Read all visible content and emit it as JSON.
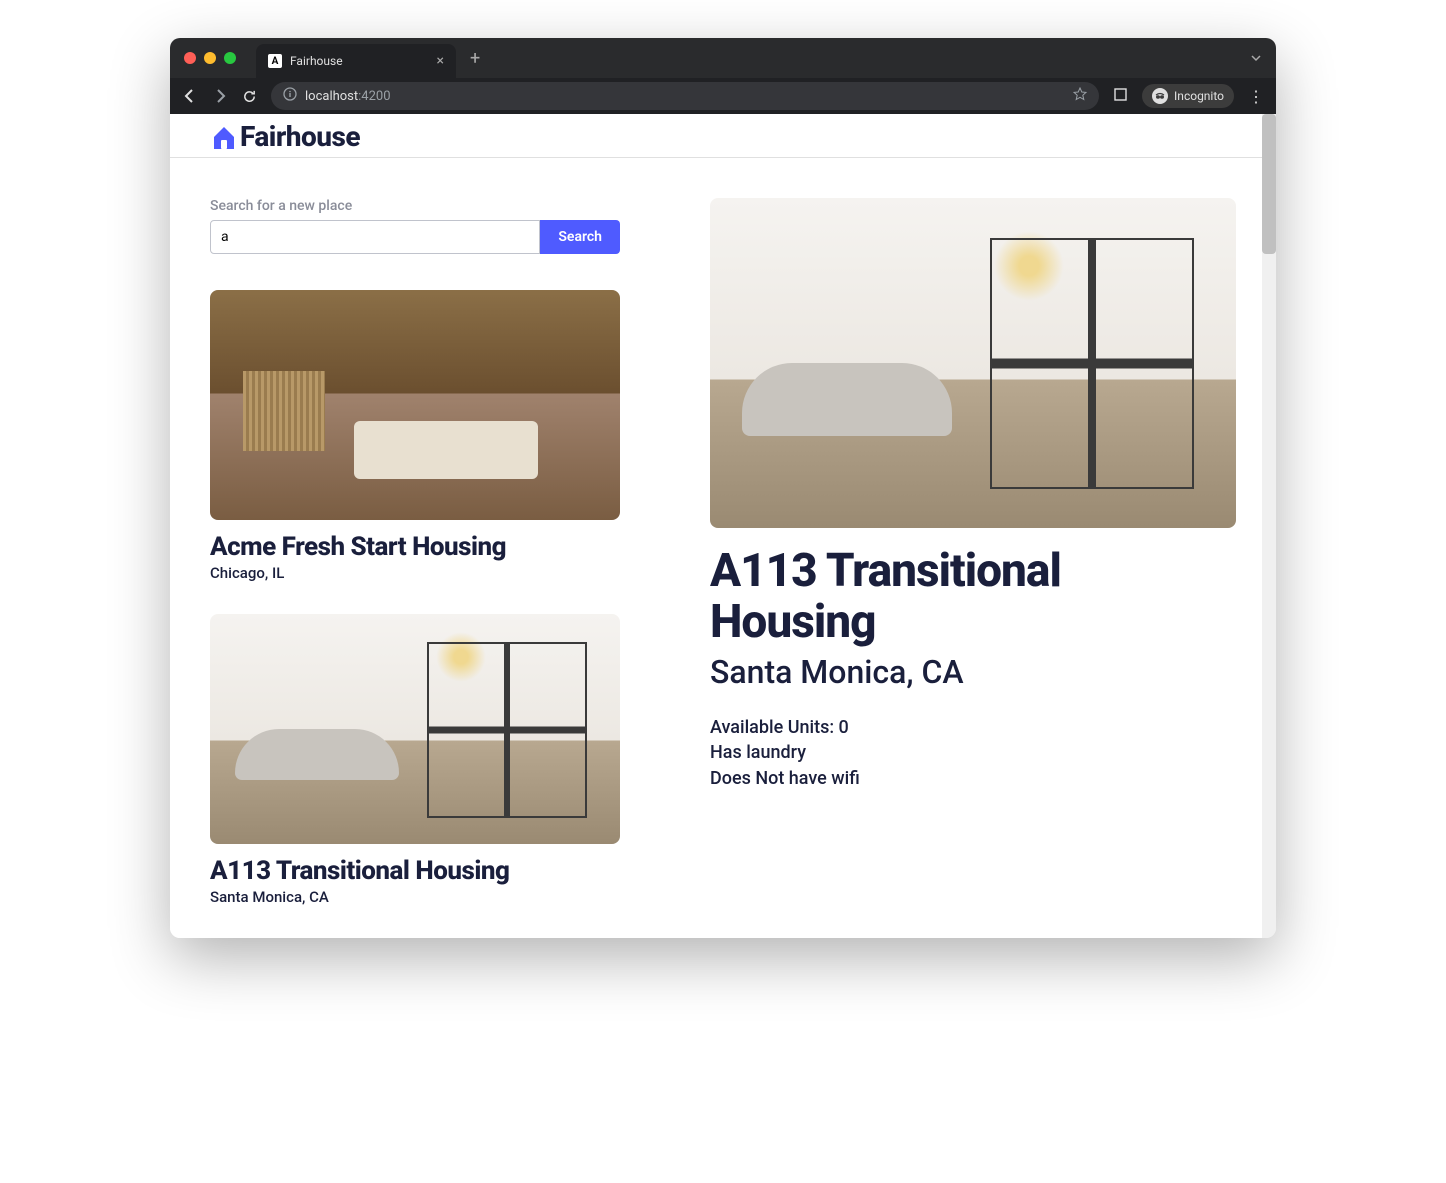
{
  "browser": {
    "tab_title": "Fairhouse",
    "tab_favicon_letter": "A",
    "address_host": "localhost",
    "address_port": ":4200",
    "incognito_label": "Incognito"
  },
  "brand": {
    "name": "Fairhouse",
    "accent_color": "#4f5bff",
    "text_color": "#1a1f3c"
  },
  "search": {
    "label": "Search for a new place",
    "value": "a",
    "button_label": "Search"
  },
  "listings": [
    {
      "title": "Acme Fresh Start Housing",
      "location": "Chicago, IL",
      "img_style": "room-warm"
    },
    {
      "title": "A113 Transitional Housing",
      "location": "Santa Monica, CA",
      "img_style": "room-light"
    }
  ],
  "detail": {
    "title": "A113 Transitional Housing",
    "location": "Santa Monica, CA",
    "available_units_label": "Available Units: 0",
    "laundry_label": "Has laundry",
    "wifi_label": "Does Not have wifi",
    "img_style": "room-light"
  }
}
